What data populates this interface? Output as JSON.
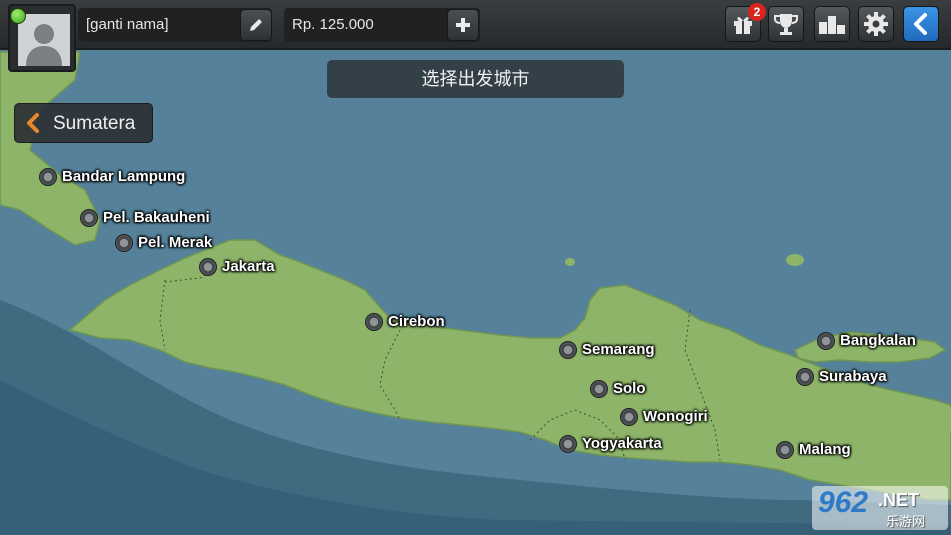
{
  "colors": {
    "sea": "#4e7a90",
    "deep_sea": "#3f6a80",
    "land": "#8db468",
    "accent_blue": "#2a7fd4",
    "badge_red": "#d8261e"
  },
  "profile": {
    "name": "[ganti nama]",
    "avatar_icon": "user-silhouette-icon",
    "status_icon": "online-dot-icon"
  },
  "wallet": {
    "amount": "Rp. 125.000"
  },
  "toolbar": {
    "gift_badge": "2",
    "icons": [
      "gift-icon",
      "trophy-icon",
      "leaderboard-icon",
      "gear-icon",
      "back-arrow-icon"
    ]
  },
  "header": {
    "title": "选择出发城市"
  },
  "region_nav": {
    "label": "Sumatera"
  },
  "cities": [
    {
      "name": "Bandar Lampung"
    },
    {
      "name": "Pel. Bakauheni"
    },
    {
      "name": "Pel. Merak"
    },
    {
      "name": "Jakarta"
    },
    {
      "name": "Cirebon"
    },
    {
      "name": "Semarang"
    },
    {
      "name": "Solo"
    },
    {
      "name": "Wonogiri"
    },
    {
      "name": "Yogyakarta"
    },
    {
      "name": "Bangkalan"
    },
    {
      "name": "Surabaya"
    },
    {
      "name": "Malang"
    }
  ],
  "watermark": {
    "brand": "962",
    "suffix": ".NET",
    "cn": "乐游网"
  }
}
